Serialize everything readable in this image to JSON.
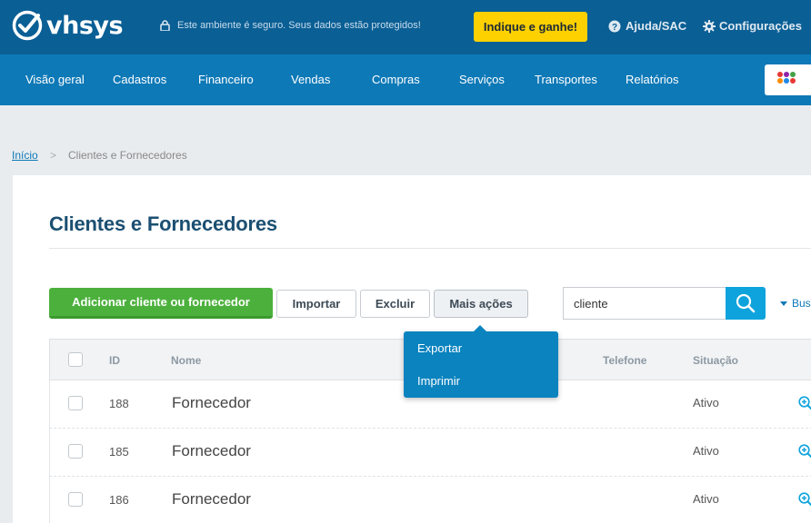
{
  "header": {
    "logo_text": "vhsys",
    "secure_text": "Este ambiente é seguro. Seus dados estão protegidos!",
    "indique_label": "Indique e ganhe!",
    "help_label": "Ajuda/SAC",
    "config_label": "Configurações"
  },
  "nav": {
    "items": [
      "Visão geral",
      "Cadastros",
      "Financeiro",
      "Vendas",
      "Compras",
      "Serviços",
      "Transportes",
      "Relatórios"
    ]
  },
  "breadcrumb": {
    "home": "Início",
    "separator": ">",
    "current": "Clientes e Fornecedores"
  },
  "page": {
    "title": "Clientes e Fornecedores"
  },
  "toolbar": {
    "add_label": "Adicionar cliente ou fornecedor",
    "import_label": "Importar",
    "delete_label": "Excluir",
    "more_label": "Mais ações",
    "search_value": "cliente",
    "advanced_search_label": "Bus"
  },
  "more_menu": {
    "items": [
      "Exportar",
      "Imprimir"
    ]
  },
  "table": {
    "columns": {
      "id": "ID",
      "name": "Nome",
      "phone": "Telefone",
      "status": "Situação"
    },
    "rows": [
      {
        "id": "188",
        "name": "Fornecedor",
        "status": "Ativo"
      },
      {
        "id": "185",
        "name": "Fornecedor",
        "status": "Ativo"
      },
      {
        "id": "186",
        "name": "Fornecedor",
        "status": "Ativo"
      }
    ]
  },
  "colors": {
    "header_bg": "#0a5f95",
    "nav_bg": "#0e79b7",
    "accent_yellow": "#fdd000",
    "add_green": "#4cb13c",
    "search_blue": "#0ea3dc",
    "dropdown_bg": "#0a83bf"
  },
  "icons": {
    "logo": "check-circle-icon",
    "secure": "lock-icon",
    "help": "question-circle-icon",
    "config": "gear-icon",
    "apps": "apps-grid-icon",
    "search": "search-icon",
    "row_action": "zoom-in-icon",
    "advanced_search": "caret-down-icon"
  }
}
